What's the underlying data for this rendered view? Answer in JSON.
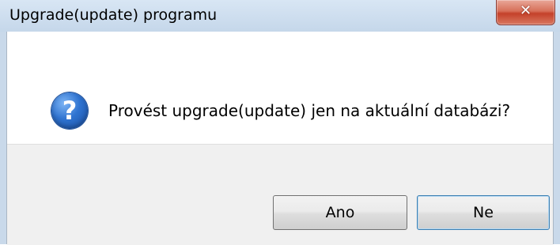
{
  "window": {
    "title": "Upgrade(update) programu",
    "close_icon": "close-icon"
  },
  "dialog": {
    "icon": "question-icon",
    "icon_glyph": "?",
    "message": "Provést upgrade(update) jen na aktuální databázi?"
  },
  "buttons": {
    "yes_label": "Ano",
    "no_label": "Ne"
  },
  "colors": {
    "titlebar": "#c5d7ea",
    "close_button": "#c4412a",
    "footer": "#f0f0f0",
    "icon_blue": "#2f73d0"
  }
}
